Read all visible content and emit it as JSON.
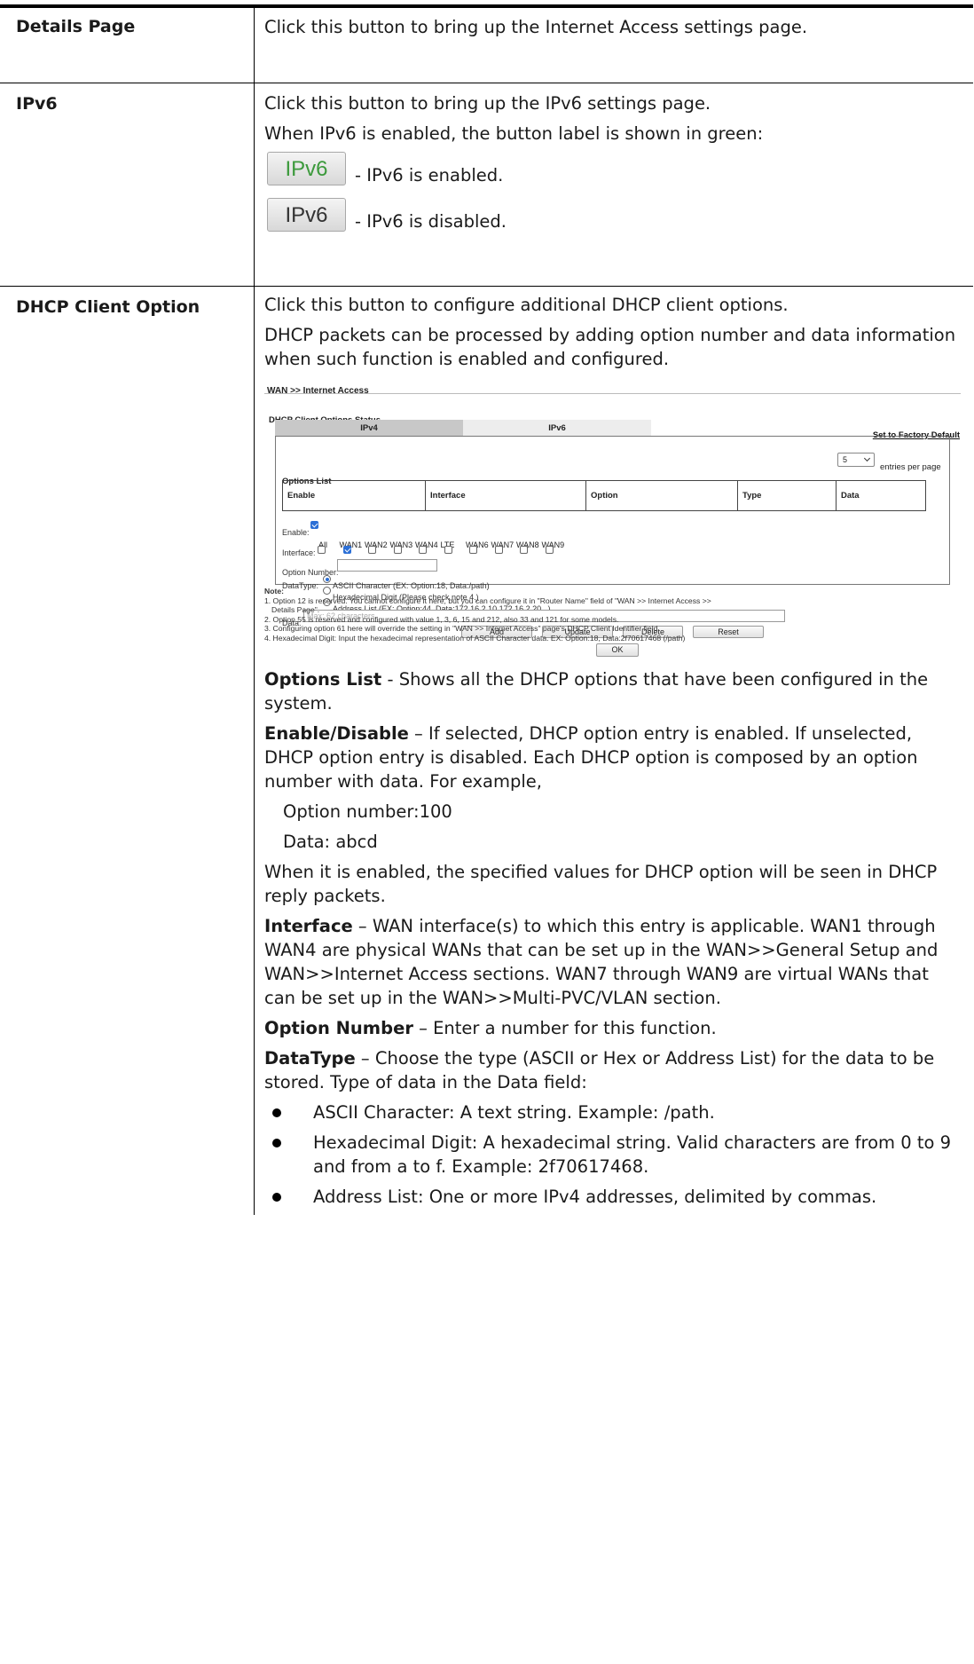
{
  "rows": [
    {
      "term": "Details Page",
      "text": "Click this button to bring up the Internet Access settings page."
    },
    {
      "term": "IPv6",
      "text1": "Click this button to bring up the IPv6 settings page.",
      "text2": "When IPv6 is enabled, the button label is shown in green:",
      "button_label": "IPv6",
      "enabled_caption": "- IPv6 is enabled.",
      "disabled_caption": "- IPv6 is disabled.",
      "enabled_color": "#3c9a3c",
      "disabled_color": "#333333"
    },
    {
      "term": "DHCP Client Option",
      "text1": "Click this button to configure additional DHCP client options.",
      "text2": "DHCP packets can be processed by adding option number and data information when such function is enabled and configured."
    }
  ],
  "screenshot": {
    "header": "WAN >> Internet Access",
    "status_title": "DHCP Client Options Status",
    "tab_ipv4": "IPv4",
    "tab_ipv6": "IPv6",
    "factory_link": "Set to Factory Default",
    "entries_value": "5",
    "entries_label": "entries per page",
    "options_list_title": "Options List",
    "columns": [
      "Enable",
      "Interface",
      "Option",
      "Type",
      "Data"
    ],
    "enable_label": "Enable:",
    "interface_label": "Interface:",
    "interfaces": [
      "All",
      "WAN1",
      "WAN2",
      "WAN3",
      "WAN4",
      "LTE",
      "WAN6",
      "WAN7",
      "WAN8",
      "WAN9"
    ],
    "interfaces_checked": [
      false,
      true,
      false,
      false,
      false,
      false,
      false,
      false,
      false,
      false
    ],
    "option_number_label": "Option Number:",
    "datatype_label": "DataType:",
    "datatype_options": [
      "ASCII Character (EX: Option:18, Data:/path)",
      "Hexadecimal Digit (Please check note 4.)",
      "Address List (EX: Option:44, Data:172.16.2.10,172.16.2.20...)"
    ],
    "data_label": "Data:",
    "data_placeholder": "Max: 62 characters",
    "buttons": {
      "add": "Add",
      "update": "Update",
      "delete": "Delete",
      "reset": "Reset",
      "ok": "OK"
    },
    "note_title": "Note:",
    "notes": [
      "1. Option 12 is reserved. You cannot configure it here, but you can configure it in \"Router Name\" field of \"WAN >> Internet Access >>",
      "    Details Page\".",
      "2. Option 55 is reserved and configured with value 1, 3, 6, 15 and 212, also 33 and 121 for some models.",
      "3. Configuring option 61 here will override the setting in \"WAN >> Internet Access\" page's DHCP Client Identifier field.",
      "4. Hexadecimal Digit: Input the hexadecimal representation of ASCII Character data. EX: Option:18, Data:2f70617468 (/path)"
    ]
  },
  "desc": {
    "options_list_label": "Options List",
    "options_list_text": " - Shows all the DHCP options that have been configured in the system.",
    "enable_label": "Enable/Disable",
    "enable_text": " – If selected, DHCP option entry is enabled. If unselected, DHCP option entry is disabled. Each DHCP option is composed by an option number with data. For example,",
    "example1": "Option number:100",
    "example2": "Data: abcd",
    "enabled_text": "When it is enabled, the specified values for DHCP option will be seen in DHCP reply packets.",
    "interface_label": "Interface",
    "interface_text": " – WAN interface(s) to which this entry is applicable. WAN1 through WAN4 are physical WANs that can be set up in the WAN>>General Setup and WAN>>Internet Access sections. WAN7 through WAN9 are virtual WANs that can be set up in the WAN>>Multi-PVC/VLAN section.",
    "option_number_label": "Option Number",
    "option_number_text": " – Enter a number for this function.",
    "datatype_label": "DataType",
    "datatype_text": " – Choose the type (ASCII or Hex or Address List) for the data to be stored. Type of data in the Data field:",
    "bullets": [
      "ASCII Character: A text string. Example: /path.",
      "Hexadecimal Digit: A hexadecimal string. Valid characters are from 0 to 9 and from a to f. Example: 2f70617468.",
      "Address List: One or more IPv4 addresses, delimited by commas."
    ]
  }
}
